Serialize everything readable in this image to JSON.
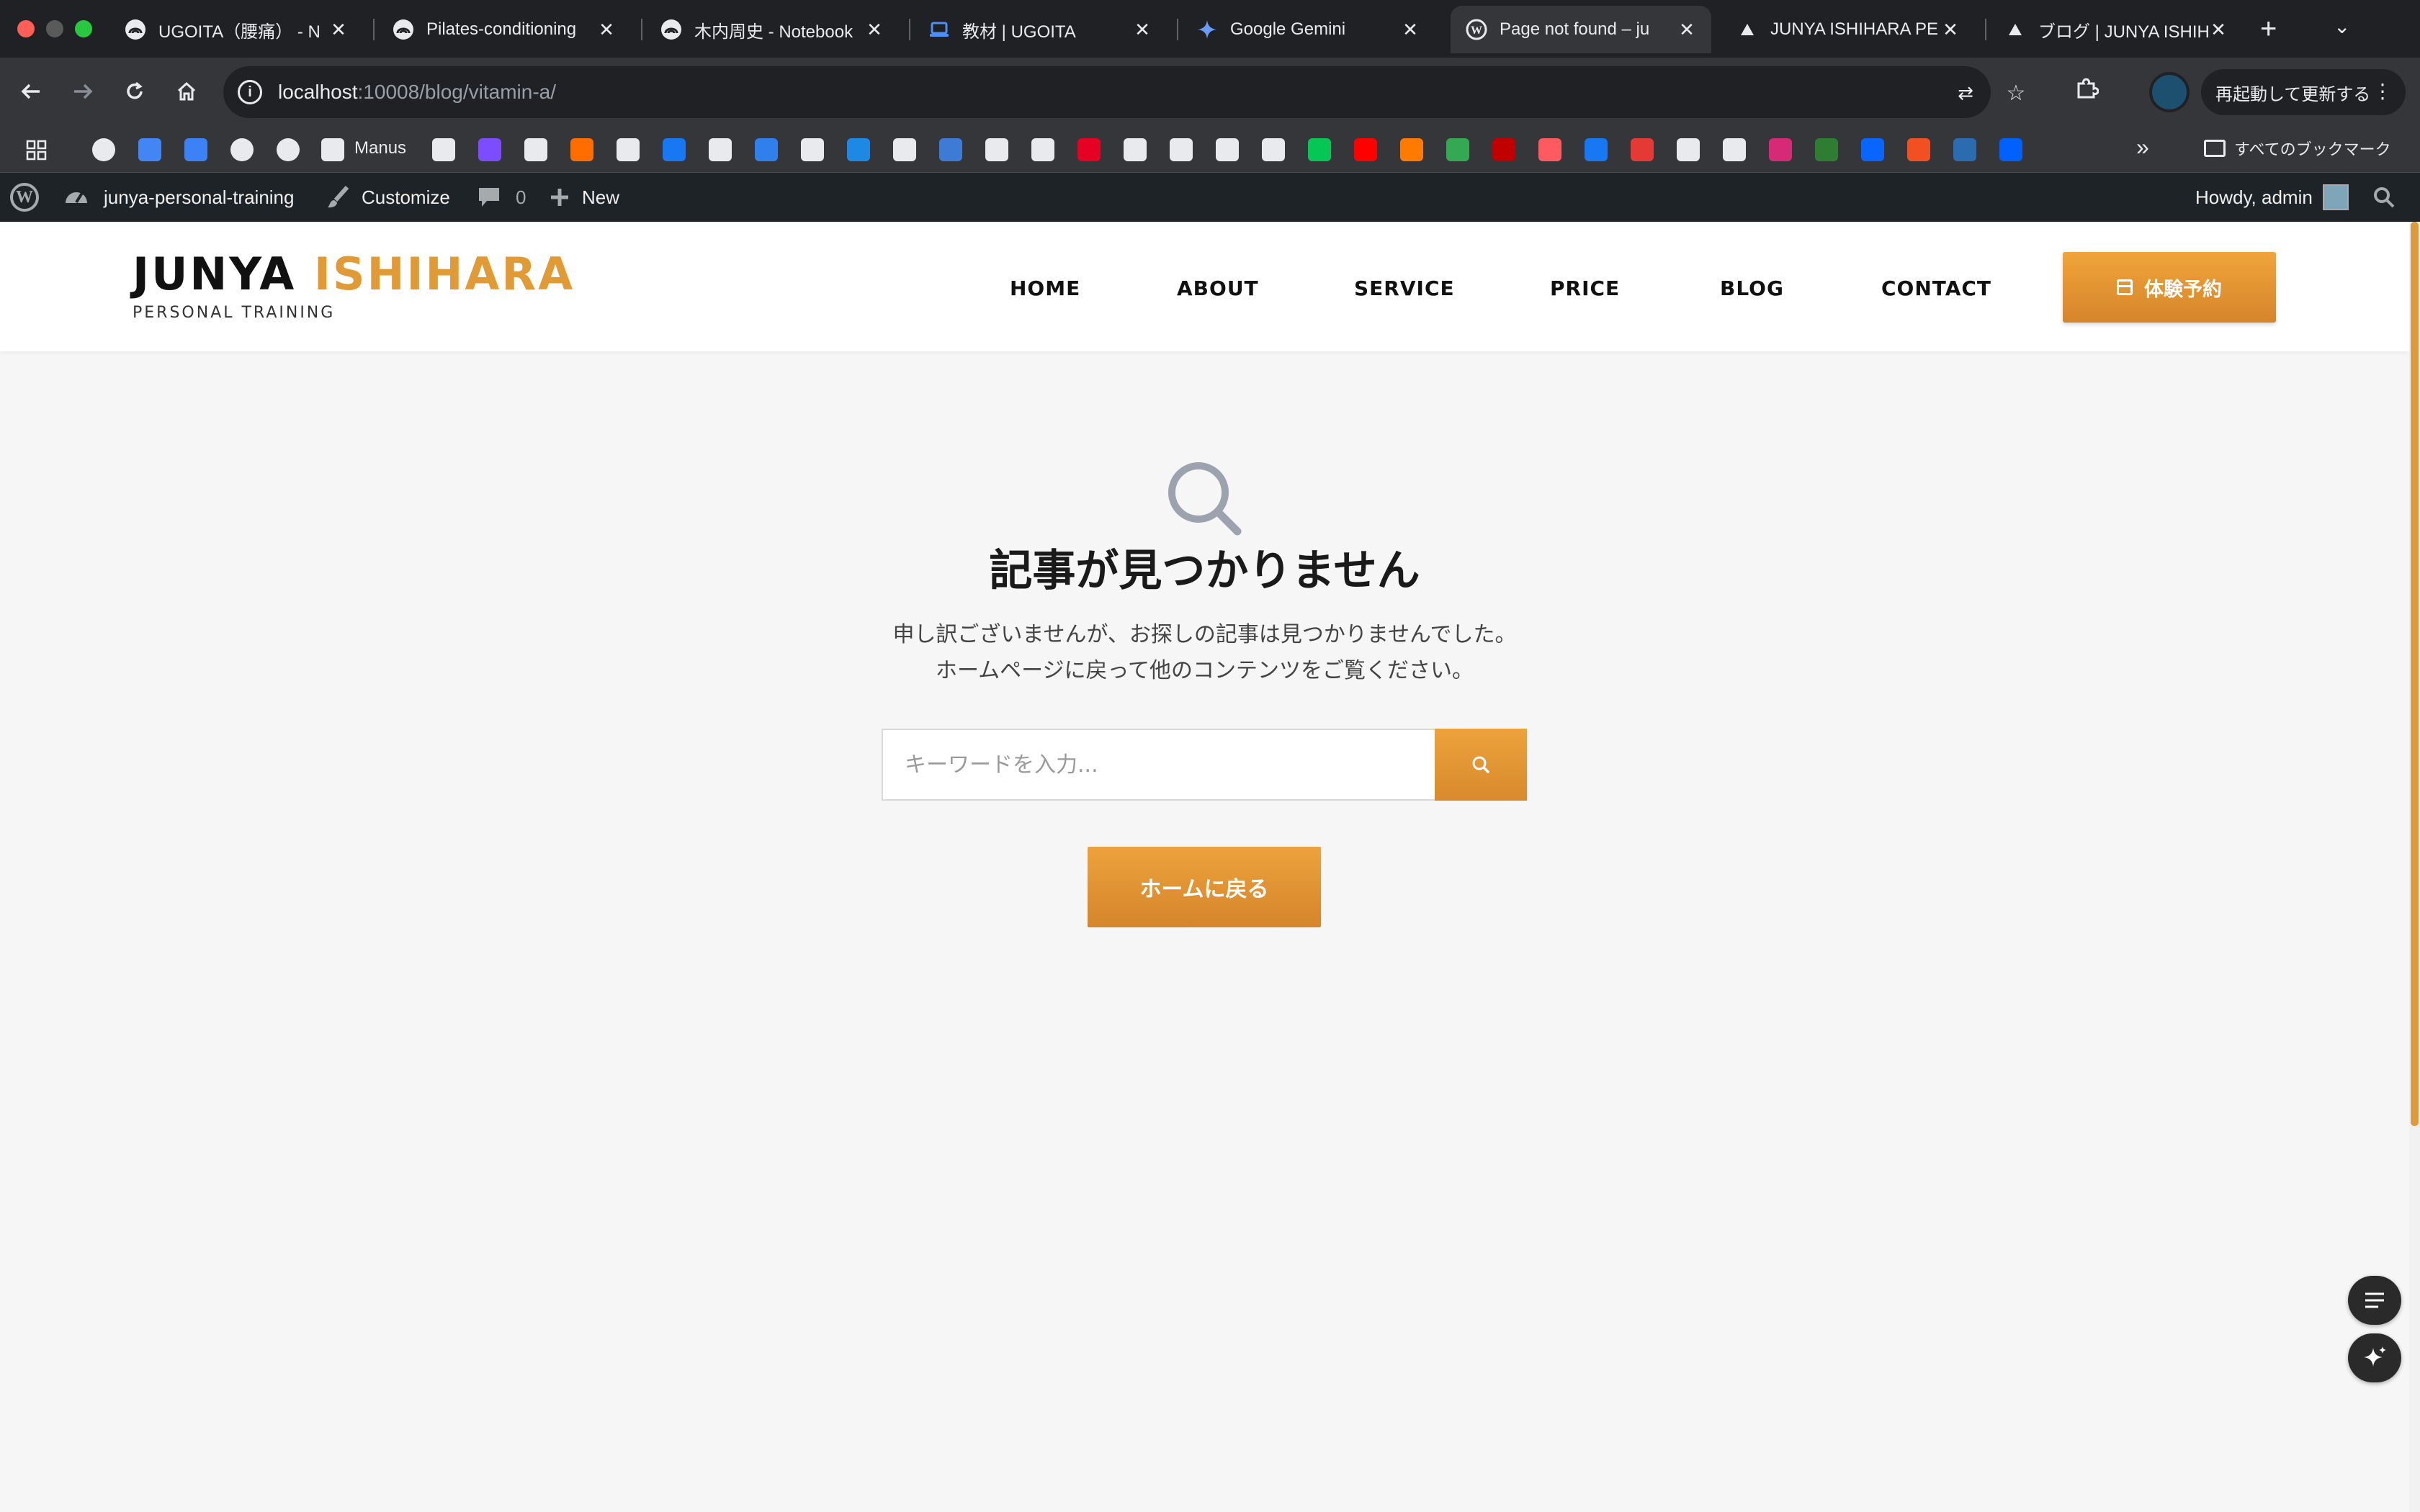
{
  "browser": {
    "tabs": [
      {
        "title": "UGOITA（腰痛） - N",
        "favicon": "notebooklm-icon",
        "active": false
      },
      {
        "title": "Pilates-conditioning",
        "favicon": "notebooklm-icon",
        "active": false
      },
      {
        "title": "木内周史 - Notebook",
        "favicon": "notebooklm-icon",
        "active": false
      },
      {
        "title": "教材 | UGOITA",
        "favicon": "laptop-icon",
        "active": false
      },
      {
        "title": "Google Gemini",
        "favicon": "gemini-icon",
        "active": false
      },
      {
        "title": "Page not found – ju",
        "favicon": "wordpress-icon",
        "active": true
      },
      {
        "title": "JUNYA ISHIHARA PE",
        "favicon": "vercel-icon",
        "active": false
      },
      {
        "title": "ブログ | JUNYA ISHIH",
        "favicon": "vercel-icon",
        "active": false
      }
    ],
    "new_tab": "+",
    "url_host": "localhost",
    "url_rest": ":10008/blog/vitamin-a/",
    "update_button": "再起動して更新する",
    "bookmarks_bar": {
      "manus_label": "Manus",
      "more": "»",
      "all_bookmarks": "すべてのブックマーク",
      "colors": [
        "#e8eaed",
        "#4285f4",
        "#3b82f6",
        "#e8eaed",
        "#e8eaed",
        "#e8eaed",
        "#e8eaed",
        "#7c4dff",
        "#e8eaed",
        "#ff6d00",
        "#e8eaed",
        "#1877f2",
        "#e8eaed",
        "#2f80ed",
        "#e8eaed",
        "#1e88e5",
        "#e8eaed",
        "#3d7bd6",
        "#e8eaed",
        "#e8eaed",
        "#e60023",
        "#e8eaed",
        "#e8eaed",
        "#e8eaed",
        "#e8eaed",
        "#06c755",
        "#ff0000",
        "#ff7a00",
        "#34a853",
        "#c00000",
        "#ff5a5f",
        "#1877f2",
        "#e53935",
        "#e8eaed",
        "#e8eaed",
        "#d62976",
        "#2e7d32",
        "#0866ff",
        "#f25022",
        "#2b6cb0",
        "#0061fe"
      ]
    }
  },
  "admin_bar": {
    "site_name": "junya-personal-training",
    "customize": "Customize",
    "comments": "0",
    "new": "New",
    "howdy": "Howdy, admin"
  },
  "site": {
    "logo_main": "JUNYA",
    "logo_accent": "ISHIHARA",
    "logo_sub": "PERSONAL TRAINING",
    "nav": [
      "HOME",
      "ABOUT",
      "SERVICE",
      "PRICE",
      "BLOG",
      "CONTACT"
    ],
    "cta": "体験予約",
    "accent_color": "#e09a36"
  },
  "not_found": {
    "title": "記事が見つかりません",
    "line1": "申し訳ございませんが、お探しの記事は見つかりませんでした。",
    "line2": "ホームページに戻って他のコンテンツをご覧ください。",
    "search_placeholder": "キーワードを入力...",
    "home_button": "ホームに戻る"
  }
}
